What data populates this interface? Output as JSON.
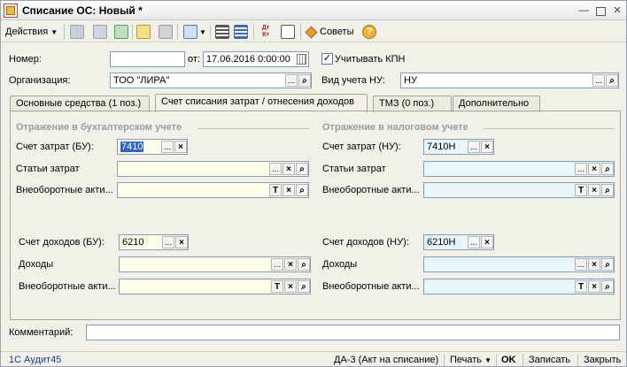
{
  "window": {
    "title": "Списание ОС: Новый *"
  },
  "toolbar": {
    "actions_label": "Действия",
    "tips_label": "Советы"
  },
  "header": {
    "number_label": "Номер:",
    "number_value": "",
    "date_label": "от:",
    "date_value": "17.06.2016  0:00:00",
    "kpn_label": "Учитывать КПН",
    "kpn_checked": "✓",
    "org_label": "Организация:",
    "org_value": "ТОО \"ЛИРА\"",
    "nu_label": "Вид учета НУ:",
    "nu_value": "НУ"
  },
  "tabs": [
    {
      "label": "Основные средства (1 поз.)"
    },
    {
      "label": "Счет списания затрат / отнесения доходов"
    },
    {
      "label": "ТМЗ (0 поз.)"
    },
    {
      "label": "Дополнительно"
    }
  ],
  "bu": {
    "section_title": "Отражение в бухгалтерском учете",
    "expense_account_label": "Счет затрат (БУ):",
    "expense_account_value": "7410",
    "expense_items_label": "Статьи затрат",
    "expense_items_value": "",
    "noncurrent1_label": "Внеоборотные акти...",
    "noncurrent1_value": "",
    "income_account_label": "Счет доходов (БУ):",
    "income_account_value": "6210",
    "income_label": "Доходы",
    "income_value": "",
    "noncurrent2_label": "Внеоборотные акти...",
    "noncurrent2_value": ""
  },
  "nu": {
    "section_title": "Отражение в налоговом учете",
    "expense_account_label": "Счет затрат (НУ):",
    "expense_account_value": "7410Н",
    "expense_items_label": "Статьи затрат",
    "expense_items_value": "",
    "noncurrent1_label": "Внеоборотные акти...",
    "noncurrent1_value": "",
    "income_account_label": "Счет доходов (НУ):",
    "income_account_value": "6210Н",
    "income_label": "Доходы",
    "income_value": "",
    "noncurrent2_label": "Внеоборотные акти...",
    "noncurrent2_value": ""
  },
  "comment": {
    "label": "Комментарий:",
    "value": ""
  },
  "status": {
    "left": "1С Аудит45",
    "doc_link": "ДА-3 (Акт на списание)",
    "print_label": "Печать",
    "ok_label": "OK",
    "save_label": "Записать",
    "close_label": "Закрыть"
  }
}
